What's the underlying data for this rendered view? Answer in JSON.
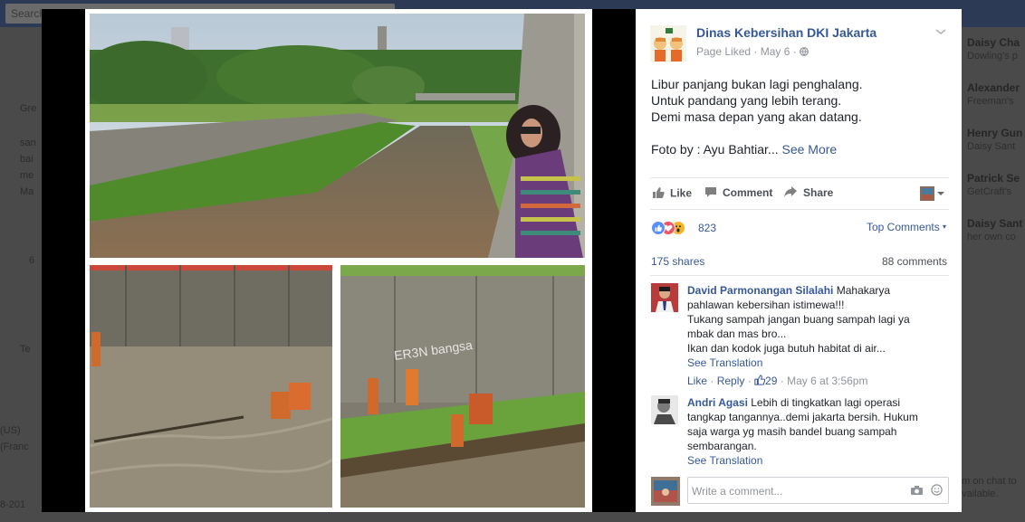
{
  "background": {
    "search_placeholder": "Search Facebook",
    "left_texts": [
      "Gre",
      "san",
      "bai",
      "me",
      "Ma",
      "6",
      "Te",
      "(US)",
      "(Franc",
      "8-201"
    ],
    "right_items": [
      {
        "name": "Daisy Cha",
        "sub": "Dowling's p"
      },
      {
        "name": "Alexander",
        "sub": "Freeman's"
      },
      {
        "name": "Henry Gun",
        "sub": "Daisy Sant"
      },
      {
        "name": "Patrick Se",
        "sub": "GetCraft's"
      },
      {
        "name": "Daisy Sant",
        "sub": "her own co"
      }
    ],
    "right_bottom": [
      "um on chat to",
      "available."
    ]
  },
  "post": {
    "page_name": "Dinas Kebersihan DKI Jakarta",
    "liked": "Page Liked",
    "date": "May 6",
    "lines": [
      "Libur panjang bukan lagi penghalang.",
      "Untuk pandang yang lebih terang.",
      "Demi masa depan yang akan datang."
    ],
    "photo_credit": "Foto by : Ayu Bahtiar...",
    "see_more": "See More"
  },
  "actions": {
    "like": "Like",
    "comment": "Comment",
    "share": "Share"
  },
  "reactions": {
    "count": "823",
    "top_comments": "Top Comments",
    "shares": "175 shares",
    "comments": "88 comments"
  },
  "comments": [
    {
      "author": "David Parmonangan Silalahi",
      "text_lines": [
        "Mahakarya",
        "pahlawan kebersihan istimewa!!!",
        "Tukang sampah jangan buang sampah lagi ya",
        "mbak dan mas bro...",
        "Ikan dan kodok juga butuh habitat di air..."
      ],
      "see_translation": "See Translation",
      "like": "Like",
      "reply": "Reply",
      "likes": "29",
      "time": "May 6 at 3:56pm"
    },
    {
      "author": "Andri Agasi",
      "text_lines": [
        "Lebih di tingkatkan lagi operasi",
        "tangkap tangannya..demi jakarta bersih. Hukum",
        "saja warga yg masih bandel buang sampah",
        "sembarangan."
      ],
      "see_translation": "See Translation"
    }
  ],
  "write_comment": {
    "placeholder": "Write a comment..."
  },
  "colors": {
    "link": "#365899",
    "text": "#1d2129",
    "muted": "#90949c",
    "like_reaction": "#5890ff",
    "love_reaction": "#f25268",
    "wow_reaction": "#f7b125"
  }
}
